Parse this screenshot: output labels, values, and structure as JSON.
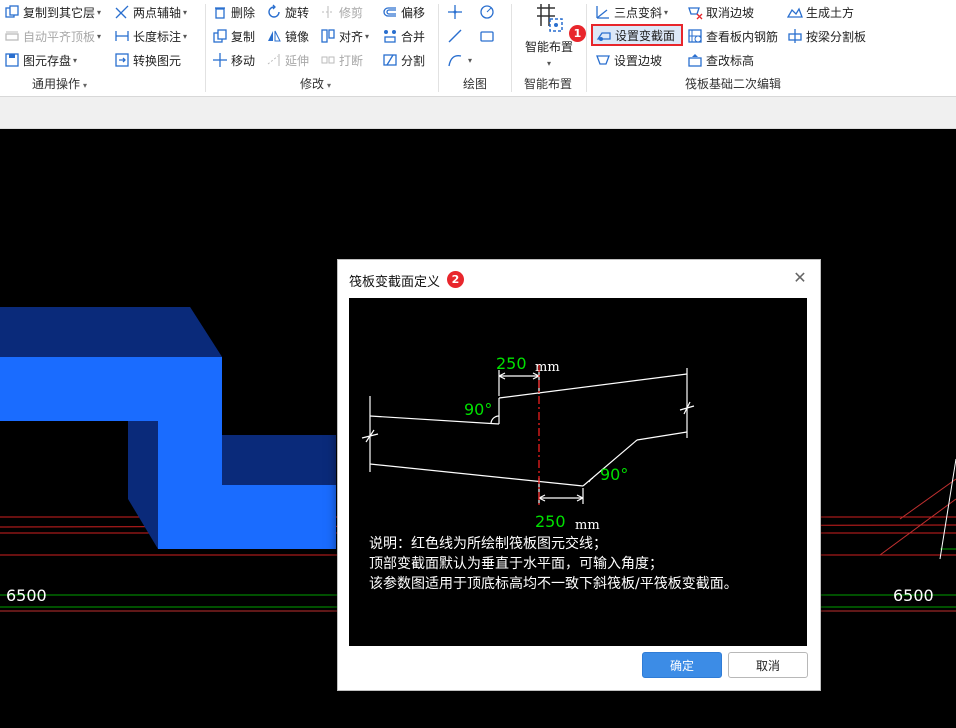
{
  "ribbon": {
    "general": {
      "label": "通用操作",
      "copy_to_layer": "复制到其它层",
      "auto_flat_top": "自动平齐顶板",
      "save_element": "图元存盘",
      "two_point_axis": "两点辅轴",
      "length_dim": "长度标注",
      "convert_element": "转换图元"
    },
    "modify": {
      "label": "修改",
      "delete": "删除",
      "copy": "复制",
      "move": "移动",
      "rotate": "旋转",
      "mirror": "镜像",
      "extend": "延伸",
      "trim": "修剪",
      "align": "对齐",
      "break": "打断",
      "offset": "偏移",
      "merge": "合并",
      "split": "分割"
    },
    "draw": {
      "label": "绘图"
    },
    "smart": {
      "label": "智能布置",
      "button": "智能布置"
    },
    "raft": {
      "label": "筏板基础二次编辑",
      "three_point_slope": "三点变斜",
      "set_section": "设置变截面",
      "set_edge_slope": "设置边坡",
      "cancel_edge_slope": "取消边坡",
      "view_rebar": "查看板内钢筋",
      "check_elevation": "查改标高",
      "gen_earthwork": "生成土方",
      "split_by_beam": "按梁分割板"
    }
  },
  "badges": {
    "one": "1",
    "two": "2"
  },
  "canvas": {
    "dim_left": "6500",
    "dim_right": "6500"
  },
  "dialog": {
    "title": "筏板变截面定义",
    "ok": "确定",
    "cancel": "取消",
    "diagram": {
      "dim_top": "250",
      "dim_bottom": "250",
      "unit_top": "mm",
      "unit_bottom": "mm",
      "angle_top": "90°",
      "angle_bottom": "90°",
      "note1": "说明：红色线为所绘制筏板图元交线；",
      "note2": "顶部变截面默认为垂直于水平面，可输入角度；",
      "note3": "该参数图适用于顶底标高均不一致下斜筏板/平筏板变截面。"
    }
  },
  "colors": {
    "accent": "#3c8ce6",
    "highlight": "#e8262c",
    "element_blue": "#1a6cff",
    "dim_green": "#00e000"
  }
}
